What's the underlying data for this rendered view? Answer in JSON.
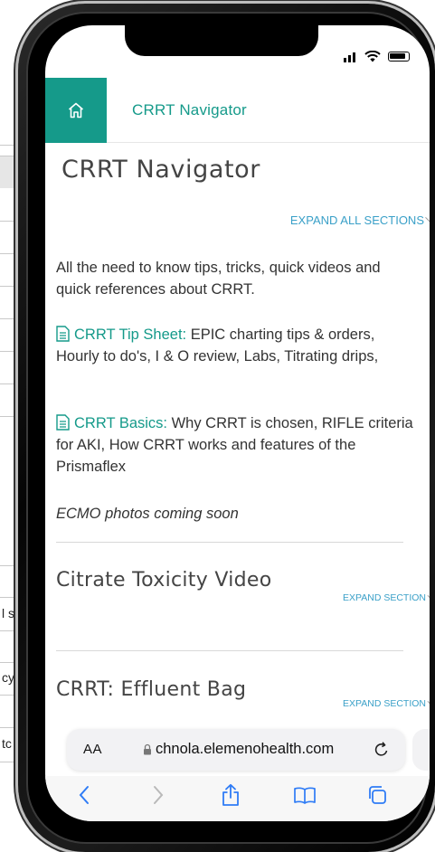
{
  "background_page": {
    "snippets": [
      "l su",
      "cy",
      "tc"
    ]
  },
  "header": {
    "title": "CRRT Navigator",
    "home_icon": "home-icon"
  },
  "page": {
    "title": "CRRT Navigator",
    "expand_all_label": "EXPAND ALL SECTIONS",
    "intro": "All the need to know tips, tricks, quick videos and quick references about CRRT.",
    "items": [
      {
        "link": "CRRT Tip Sheet:",
        "text": " EPIC charting tips & orders, Hourly to do's, I & O review, Labs, Titrating drips,"
      },
      {
        "link": "CRRT Basics:",
        "text": " Why CRRT is chosen, RIFLE criteria for AKI, How CRRT works and features of the Prismaflex"
      }
    ],
    "note": "ECMO photos coming soon"
  },
  "sections": [
    {
      "title": "Citrate Toxicity Video",
      "expand_label": "EXPAND SECTION"
    },
    {
      "title": "CRRT: Effluent Bag",
      "expand_label": "EXPAND SECTION"
    }
  ],
  "browser": {
    "text_size_label": "AA",
    "url": "chnola.elemenohealth.com"
  },
  "colors": {
    "accent": "#159a8a",
    "link_blue": "#3aa0c8"
  }
}
